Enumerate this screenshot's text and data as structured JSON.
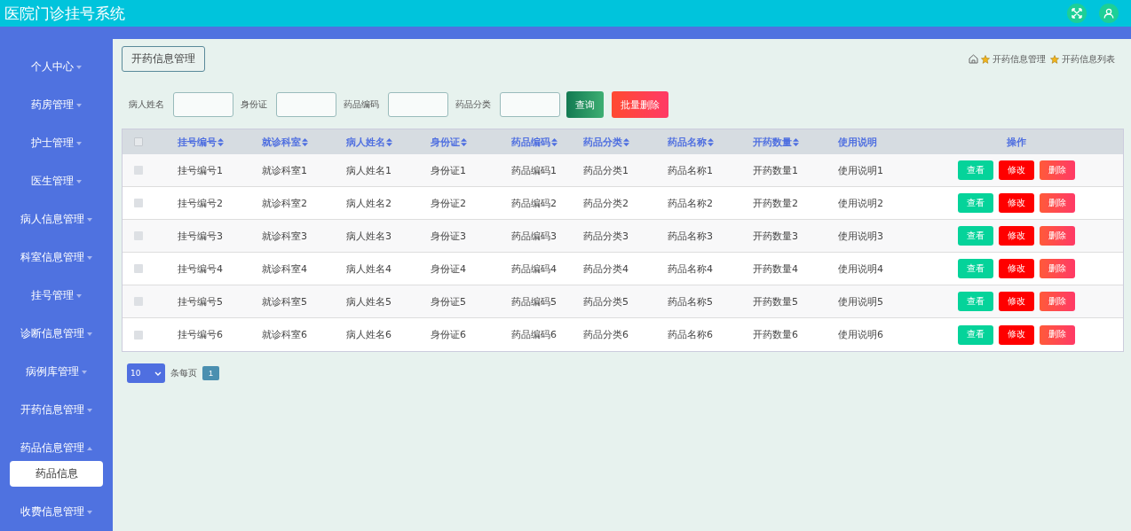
{
  "header": {
    "title": "医院门诊挂号系统"
  },
  "sidebar": {
    "items": [
      {
        "label": "个人中心",
        "expanded": false
      },
      {
        "label": "药房管理",
        "expanded": false
      },
      {
        "label": "护士管理",
        "expanded": false
      },
      {
        "label": "医生管理",
        "expanded": false
      },
      {
        "label": "病人信息管理",
        "expanded": false
      },
      {
        "label": "科室信息管理",
        "expanded": false
      },
      {
        "label": "挂号管理",
        "expanded": false
      },
      {
        "label": "诊断信息管理",
        "expanded": false
      },
      {
        "label": "病例库管理",
        "expanded": false
      },
      {
        "label": "开药信息管理",
        "expanded": false
      },
      {
        "label": "药品信息管理",
        "expanded": true,
        "children": [
          {
            "label": "药品信息",
            "selected": true
          }
        ]
      },
      {
        "label": "收费信息管理",
        "expanded": false
      }
    ]
  },
  "page_tab": {
    "label": "开药信息管理"
  },
  "breadcrumb": [
    "开药信息管理",
    "开药信息列表"
  ],
  "search": {
    "fields": [
      {
        "label": "病人姓名"
      },
      {
        "label": "身份证"
      },
      {
        "label": "药品编码"
      },
      {
        "label": "药品分类"
      }
    ],
    "buttons": [
      {
        "label": "查询",
        "kind": "search"
      },
      {
        "label": "批量删除",
        "kind": "delete"
      }
    ]
  },
  "table": {
    "select_all_checked": false,
    "columns": [
      {
        "label": "挂号编号",
        "sortable": true
      },
      {
        "label": "就诊科室",
        "sortable": true
      },
      {
        "label": "病人姓名",
        "sortable": true
      },
      {
        "label": "身份证",
        "sortable": true
      },
      {
        "label": "药品编码",
        "sortable": true
      },
      {
        "label": "药品分类",
        "sortable": true
      },
      {
        "label": "药品名称",
        "sortable": true
      },
      {
        "label": "开药数量",
        "sortable": true
      },
      {
        "label": "使用说明",
        "sortable": false
      },
      {
        "label": "操作",
        "sortable": false
      }
    ],
    "rows": [
      {
        "checked": false,
        "cells": [
          "挂号编号1",
          "就诊科室1",
          "病人姓名1",
          "身份证1",
          "药品编码1",
          "药品分类1",
          "药品名称1",
          "开药数量1",
          "使用说明1"
        ],
        "actions": [
          {
            "label": "查看",
            "kind": "view"
          },
          {
            "label": "修改",
            "kind": "edit"
          },
          {
            "label": "删除",
            "kind": "delete"
          }
        ]
      },
      {
        "checked": false,
        "cells": [
          "挂号编号2",
          "就诊科室2",
          "病人姓名2",
          "身份证2",
          "药品编码2",
          "药品分类2",
          "药品名称2",
          "开药数量2",
          "使用说明2"
        ],
        "actions": [
          {
            "label": "查看",
            "kind": "view"
          },
          {
            "label": "修改",
            "kind": "edit"
          },
          {
            "label": "删除",
            "kind": "delete"
          }
        ]
      },
      {
        "checked": false,
        "cells": [
          "挂号编号3",
          "就诊科室3",
          "病人姓名3",
          "身份证3",
          "药品编码3",
          "药品分类3",
          "药品名称3",
          "开药数量3",
          "使用说明3"
        ],
        "actions": [
          {
            "label": "查看",
            "kind": "view"
          },
          {
            "label": "修改",
            "kind": "edit"
          },
          {
            "label": "删除",
            "kind": "delete"
          }
        ]
      },
      {
        "checked": false,
        "cells": [
          "挂号编号4",
          "就诊科室4",
          "病人姓名4",
          "身份证4",
          "药品编码4",
          "药品分类4",
          "药品名称4",
          "开药数量4",
          "使用说明4"
        ],
        "actions": [
          {
            "label": "查看",
            "kind": "view"
          },
          {
            "label": "修改",
            "kind": "edit"
          },
          {
            "label": "删除",
            "kind": "delete"
          }
        ]
      },
      {
        "checked": false,
        "cells": [
          "挂号编号5",
          "就诊科室5",
          "病人姓名5",
          "身份证5",
          "药品编码5",
          "药品分类5",
          "药品名称5",
          "开药数量5",
          "使用说明5"
        ],
        "actions": [
          {
            "label": "查看",
            "kind": "view"
          },
          {
            "label": "修改",
            "kind": "edit"
          },
          {
            "label": "删除",
            "kind": "delete"
          }
        ]
      },
      {
        "checked": false,
        "cells": [
          "挂号编号6",
          "就诊科室6",
          "病人姓名6",
          "身份证6",
          "药品编码6",
          "药品分类6",
          "药品名称6",
          "开药数量6",
          "使用说明6"
        ],
        "actions": [
          {
            "label": "查看",
            "kind": "view"
          },
          {
            "label": "修改",
            "kind": "edit"
          },
          {
            "label": "删除",
            "kind": "delete"
          }
        ]
      }
    ]
  },
  "pagination": {
    "page_size": "10",
    "per_page_label": "条每页",
    "pages": [
      {
        "label": "1",
        "selected": true
      }
    ]
  }
}
